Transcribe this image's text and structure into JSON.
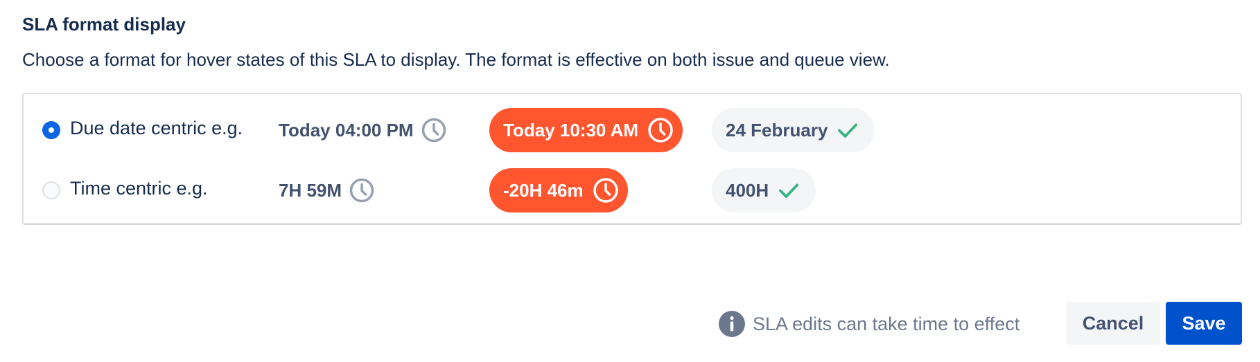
{
  "section": {
    "title": "SLA format display",
    "description": "Choose a format for hover states of this SLA to display. The format is effective on both issue and queue view."
  },
  "options": [
    {
      "label": "Due date centric e.g.",
      "selected": true,
      "examples": {
        "ongoing": "Today 04:00 PM",
        "breached": "Today 10:30 AM",
        "met": "24 February"
      }
    },
    {
      "label": "Time centric e.g.",
      "selected": false,
      "examples": {
        "ongoing": "7H 59M",
        "breached": "-20H 46m",
        "met": "400H"
      }
    }
  ],
  "footer": {
    "note": "SLA edits can take time to effect",
    "cancel_label": "Cancel",
    "save_label": "Save"
  },
  "icons": {
    "ongoing": "clock-icon",
    "breached": "clock-icon",
    "met": "check-icon",
    "note": "info-icon"
  },
  "colors": {
    "breached_bg": "#ff5630",
    "met_bg": "#f4f5f7",
    "check": "#36b37e",
    "primary": "#0052cc",
    "radio_selected": "#0c66e4"
  }
}
